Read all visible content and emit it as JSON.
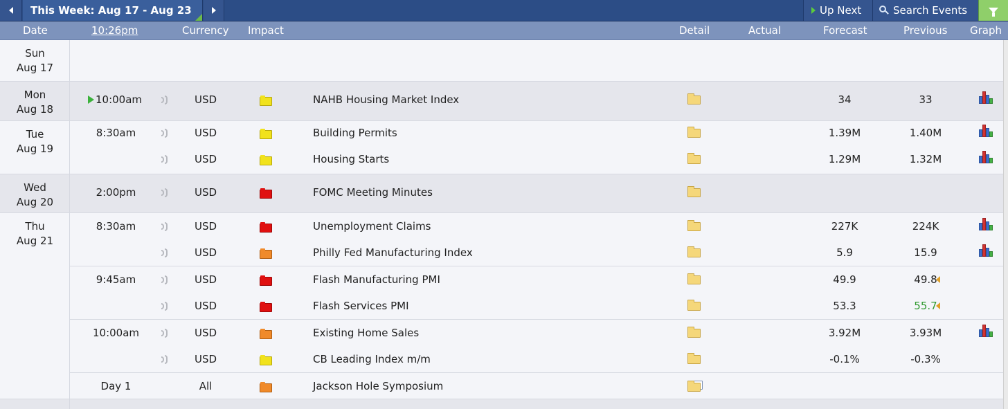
{
  "topbar": {
    "week_title": "This Week: Aug 17 - Aug 23",
    "up_next_label": "Up Next",
    "search_label": "Search Events"
  },
  "header": {
    "date": "Date",
    "time": "10:26pm",
    "currency": "Currency",
    "impact": "Impact",
    "detail": "Detail",
    "actual": "Actual",
    "forecast": "Forecast",
    "previous": "Previous",
    "graph": "Graph"
  },
  "days": [
    {
      "dow": "Sun",
      "date": "Aug 17"
    },
    {
      "dow": "Mon",
      "date": "Aug 18"
    },
    {
      "dow": "Tue",
      "date": "Aug 19"
    },
    {
      "dow": "Wed",
      "date": "Aug 20"
    },
    {
      "dow": "Thu",
      "date": "Aug 21"
    }
  ],
  "events": [
    {
      "time": "10:00am",
      "currency": "USD",
      "impact": "yellow",
      "name": "NAHB Housing Market Index",
      "forecast": "34",
      "previous": "33",
      "graph": true,
      "next_up": true
    },
    {
      "time": "8:30am",
      "currency": "USD",
      "impact": "yellow",
      "name": "Building Permits",
      "forecast": "1.39M",
      "previous": "1.40M",
      "graph": true
    },
    {
      "time": "",
      "currency": "USD",
      "impact": "yellow",
      "name": "Housing Starts",
      "forecast": "1.29M",
      "previous": "1.32M",
      "graph": true
    },
    {
      "time": "2:00pm",
      "currency": "USD",
      "impact": "red",
      "name": "FOMC Meeting Minutes",
      "forecast": "",
      "previous": "",
      "graph": false
    },
    {
      "time": "8:30am",
      "currency": "USD",
      "impact": "red",
      "name": "Unemployment Claims",
      "forecast": "227K",
      "previous": "224K",
      "graph": true
    },
    {
      "time": "",
      "currency": "USD",
      "impact": "orange",
      "name": "Philly Fed Manufacturing Index",
      "forecast": "5.9",
      "previous": "15.9",
      "graph": true
    },
    {
      "time": "9:45am",
      "currency": "USD",
      "impact": "red",
      "name": "Flash Manufacturing PMI",
      "forecast": "49.9",
      "previous": "49.8",
      "graph": false,
      "revised": true
    },
    {
      "time": "",
      "currency": "USD",
      "impact": "red",
      "name": "Flash Services PMI",
      "forecast": "53.3",
      "previous": "55.7",
      "graph": false,
      "revised": true,
      "previous_better": true
    },
    {
      "time": "10:00am",
      "currency": "USD",
      "impact": "orange",
      "name": "Existing Home Sales",
      "forecast": "3.92M",
      "previous": "3.93M",
      "graph": true
    },
    {
      "time": "",
      "currency": "USD",
      "impact": "yellow",
      "name": "CB Leading Index m/m",
      "forecast": "-0.1%",
      "previous": "-0.3%",
      "graph": false
    },
    {
      "time": "Day 1",
      "currency": "All",
      "impact": "orange",
      "name": "Jackson Hole Symposium",
      "forecast": "",
      "previous": "",
      "graph": false
    }
  ],
  "impact_colors": {
    "yellow": "#f1e21c",
    "orange": "#f08a2a",
    "red": "#e01010"
  },
  "icons": {
    "detail": "folder-icon",
    "graph": "bar-chart-icon",
    "sound": "sound-wave-icon"
  }
}
